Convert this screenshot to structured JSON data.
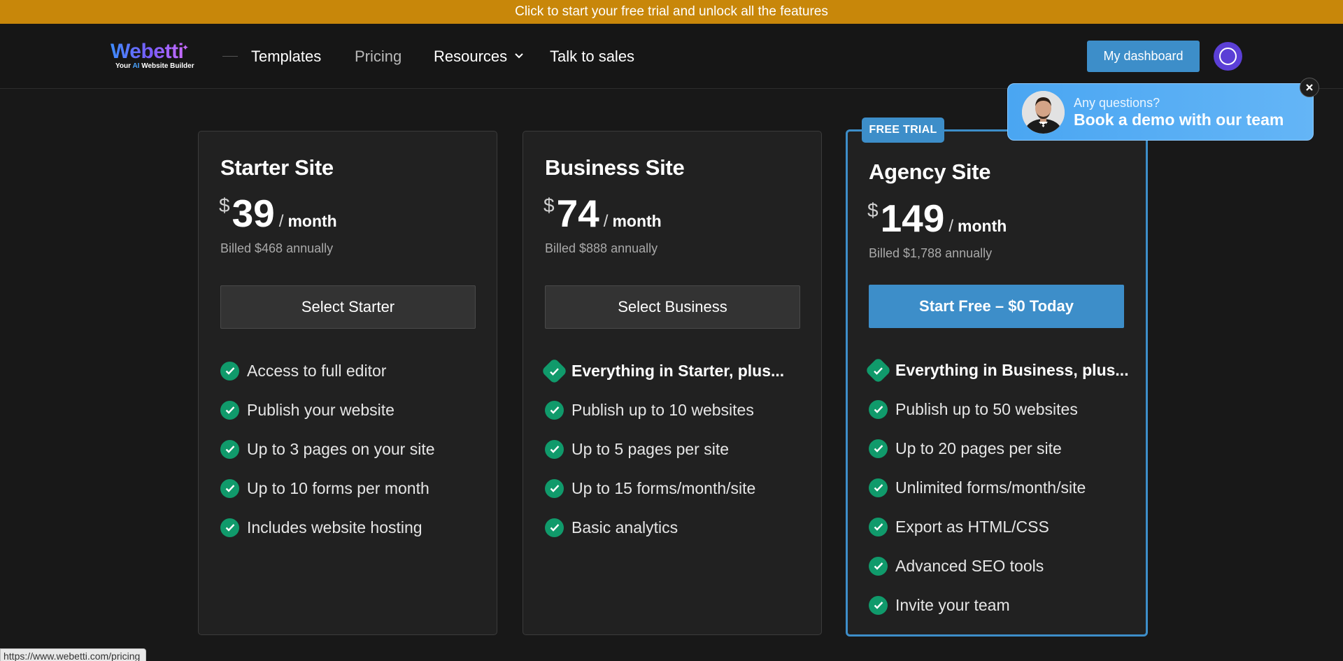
{
  "promo": {
    "text": "Click to start your free trial and unlock all the features"
  },
  "header": {
    "logo": {
      "name": "Webetti",
      "tag_prefix": "Your ",
      "tag_ai": "AI",
      "tag_suffix": " Website Builder"
    },
    "nav": [
      {
        "label": "Templates"
      },
      {
        "label": "Pricing"
      },
      {
        "label": "Resources"
      },
      {
        "label": "Talk to sales"
      }
    ],
    "dashboard_label": "My dashboard"
  },
  "plans": [
    {
      "name": "Starter Site",
      "currency": "$",
      "price": "39",
      "slash": "/",
      "period": "month",
      "billed": "Billed $468 annually",
      "cta": "Select Starter",
      "features": [
        "Access to full editor",
        "Publish your website",
        "Up to 3 pages on your site",
        "Up to 10 forms per month",
        "Includes website hosting"
      ]
    },
    {
      "name": "Business Site",
      "currency": "$",
      "price": "74",
      "slash": "/",
      "period": "month",
      "billed": "Billed $888 annually",
      "cta": "Select Business",
      "features": [
        "Everything in Starter, plus...",
        "Publish up to 10 websites",
        "Up to 5 pages per site",
        "Up to 15 forms/month/site",
        "Basic analytics"
      ]
    },
    {
      "name": "Agency Site",
      "badge": "FREE TRIAL",
      "currency": "$",
      "price": "149",
      "slash": "/",
      "period": "month",
      "billed": "Billed $1,788 annually",
      "cta": "Start Free – $0 Today",
      "features": [
        "Everything in Business, plus...",
        "Publish up to 50 websites",
        "Up to 20 pages per site",
        "Unlimited forms/month/site",
        "Export as HTML/CSS",
        "Advanced SEO tools",
        "Invite your team"
      ]
    }
  ],
  "demo_widget": {
    "question": "Any questions?",
    "cta": "Book a demo with our team"
  },
  "status_bar": {
    "url": "https://www.webetti.com/pricing"
  },
  "colors": {
    "accent": "#3d8ec9",
    "check": "#109a6b",
    "promo": "#c8870a",
    "background": "#181818",
    "card": "#212121"
  },
  "icons": {
    "feature": "check-circle-icon",
    "lead_feature": "check-badge-icon",
    "dropdown": "chevron-down-icon",
    "close": "close-icon",
    "avatar": "circle-icon"
  }
}
